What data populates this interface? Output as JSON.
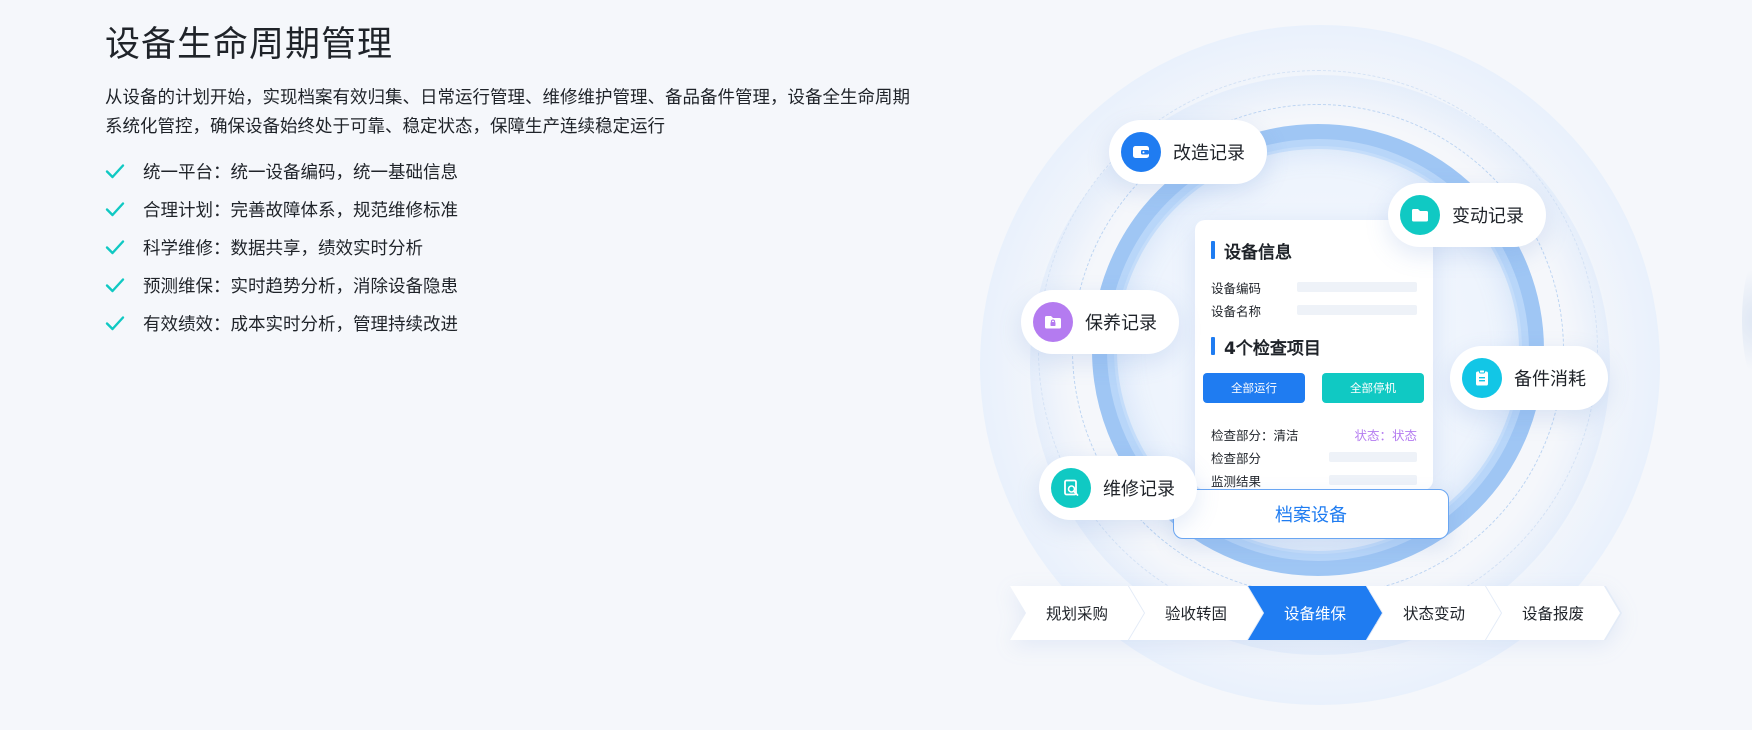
{
  "title": "设备生命周期管理",
  "description": "从设备的计划开始，实现档案有效归集、日常运行管理、维修维护管理、备品备件管理，设备全生命周期系统化管控，确保设备始终处于可靠、稳定状态，保障生产连续稳定运行",
  "features": [
    "统一平台：统一设备编码，统一基础信息",
    "合理计划：完善故障体系，规范维修标准",
    "科学维修：数据共享，绩效实时分析",
    "预测维保：实时趋势分析，消除设备隐患",
    "有效绩效：成本实时分析，管理持续改进"
  ],
  "colors": {
    "accent": "#1f7cf1",
    "teal": "#10c9c3",
    "check": "#10c9c3",
    "purple": "#b47bf0",
    "cyan": "#12c6e6"
  },
  "card": {
    "section1_title": "设备信息",
    "field_code": "设备编码",
    "field_name": "设备名称",
    "section2_title": "4个检查项目",
    "btn_run": "全部运行",
    "btn_stop": "全部停机",
    "check_part_clean": "检查部分：清洁",
    "status_text": "状态：状态",
    "check_part": "检查部分",
    "monitor_result": "监测结果"
  },
  "archive_label": "档案设备",
  "records": [
    {
      "label": "改造记录",
      "icon": "wallet-icon"
    },
    {
      "label": "变动记录",
      "icon": "folder-icon"
    },
    {
      "label": "保养记录",
      "icon": "folder-lock-icon"
    },
    {
      "label": "备件消耗",
      "icon": "clipboard-icon"
    },
    {
      "label": "维修记录",
      "icon": "document-search-icon"
    }
  ],
  "steps": [
    {
      "label": "规划采购",
      "active": false
    },
    {
      "label": "验收转固",
      "active": false
    },
    {
      "label": "设备维保",
      "active": true
    },
    {
      "label": "状态变动",
      "active": false
    },
    {
      "label": "设备报废",
      "active": false
    }
  ]
}
